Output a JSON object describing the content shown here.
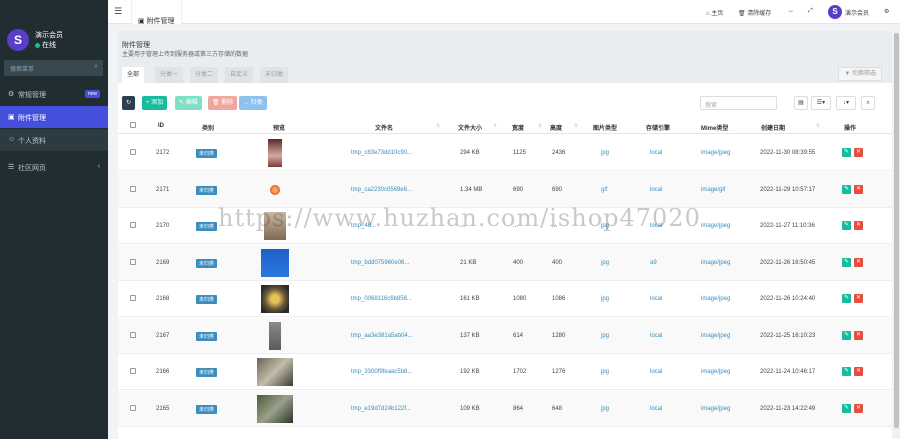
{
  "sidebar": {
    "user_name": "演示会员",
    "user_status": "在线",
    "search_placeholder": "搜索菜单",
    "items": [
      {
        "label": "常规管理",
        "badge": "new"
      },
      {
        "label": "附件管理"
      },
      {
        "label": "个人资料"
      },
      {
        "label": "社区网页"
      }
    ]
  },
  "topbar": {
    "tab_label": "附件管理",
    "home": "主页",
    "clear_cache": "清除缓存",
    "user": "演示会员"
  },
  "panel": {
    "title": "附件管理",
    "description": "主要用于管理上传到服务器或第三方存储的数据",
    "tabs": [
      "全部",
      "分类一",
      "分类二",
      "自定义",
      "未归类"
    ],
    "filter_label": "切换筛选",
    "search_placeholder": "搜索"
  },
  "toolbar": {
    "add": "添加",
    "edit": "编辑",
    "delete": "删除",
    "classify": "归类"
  },
  "table": {
    "headers": [
      "ID",
      "类别",
      "预览",
      "文件名",
      "文件大小",
      "宽度",
      "高度",
      "图片类型",
      "存储引擎",
      "Mime类型",
      "创建日期",
      "操作"
    ],
    "rows": [
      {
        "id": "2172",
        "cat": "未归类",
        "filename": "tmp_c83e73dd10c90...",
        "size": "294 KB",
        "w": "1125",
        "h": "2436",
        "type": "jpg",
        "engine": "local",
        "mime": "image/jpeg",
        "date": "2022-11-30 08:39:55"
      },
      {
        "id": "2171",
        "cat": "未归类",
        "filename": "tmp_ca2230c0569e6...",
        "size": "1.34 MB",
        "w": "690",
        "h": "690",
        "type": "gif",
        "engine": "local",
        "mime": "image/gif",
        "date": "2022-11-29 10:57:17"
      },
      {
        "id": "2170",
        "cat": "未归类",
        "filename": "tmp_4d...",
        "size": "...",
        "w": "...",
        "h": "...",
        "type": "jpg",
        "engine": "local",
        "mime": "image/jpeg",
        "date": "2022-11-27 11:10:36"
      },
      {
        "id": "2169",
        "cat": "未归类",
        "filename": "tmp_bdd075960e06...",
        "size": "21 KB",
        "w": "400",
        "h": "400",
        "type": "jpg",
        "engine": "a9",
        "mime": "image/jpeg",
        "date": "2022-11-26 16:50:45"
      },
      {
        "id": "2168",
        "cat": "未归类",
        "filename": "tmp_0068116c6b858...",
        "size": "161 KB",
        "w": "1080",
        "h": "1086",
        "type": "jpg",
        "engine": "local",
        "mime": "image/jpeg",
        "date": "2022-11-26 10:24:40"
      },
      {
        "id": "2167",
        "cat": "未归类",
        "filename": "tmp_aa3e381a5ab04...",
        "size": "137 KB",
        "w": "614",
        "h": "1280",
        "type": "jpg",
        "engine": "local",
        "mime": "image/jpeg",
        "date": "2022-11-25 16:10:23"
      },
      {
        "id": "2166",
        "cat": "未归类",
        "filename": "tmp_3300f9feaac5b8...",
        "size": "192 KB",
        "w": "1702",
        "h": "1276",
        "type": "jpg",
        "engine": "local",
        "mime": "image/jpeg",
        "date": "2022-11-24 10:46:17"
      },
      {
        "id": "2165",
        "cat": "未归类",
        "filename": "tmp_e19d7d24b122f...",
        "size": "109 KB",
        "w": "864",
        "h": "648",
        "type": "jpg",
        "engine": "local",
        "mime": "image/jpeg",
        "date": "2022-11-23 14:22:49"
      }
    ]
  },
  "watermark": "https://www.huzhan.com/ishop47020"
}
